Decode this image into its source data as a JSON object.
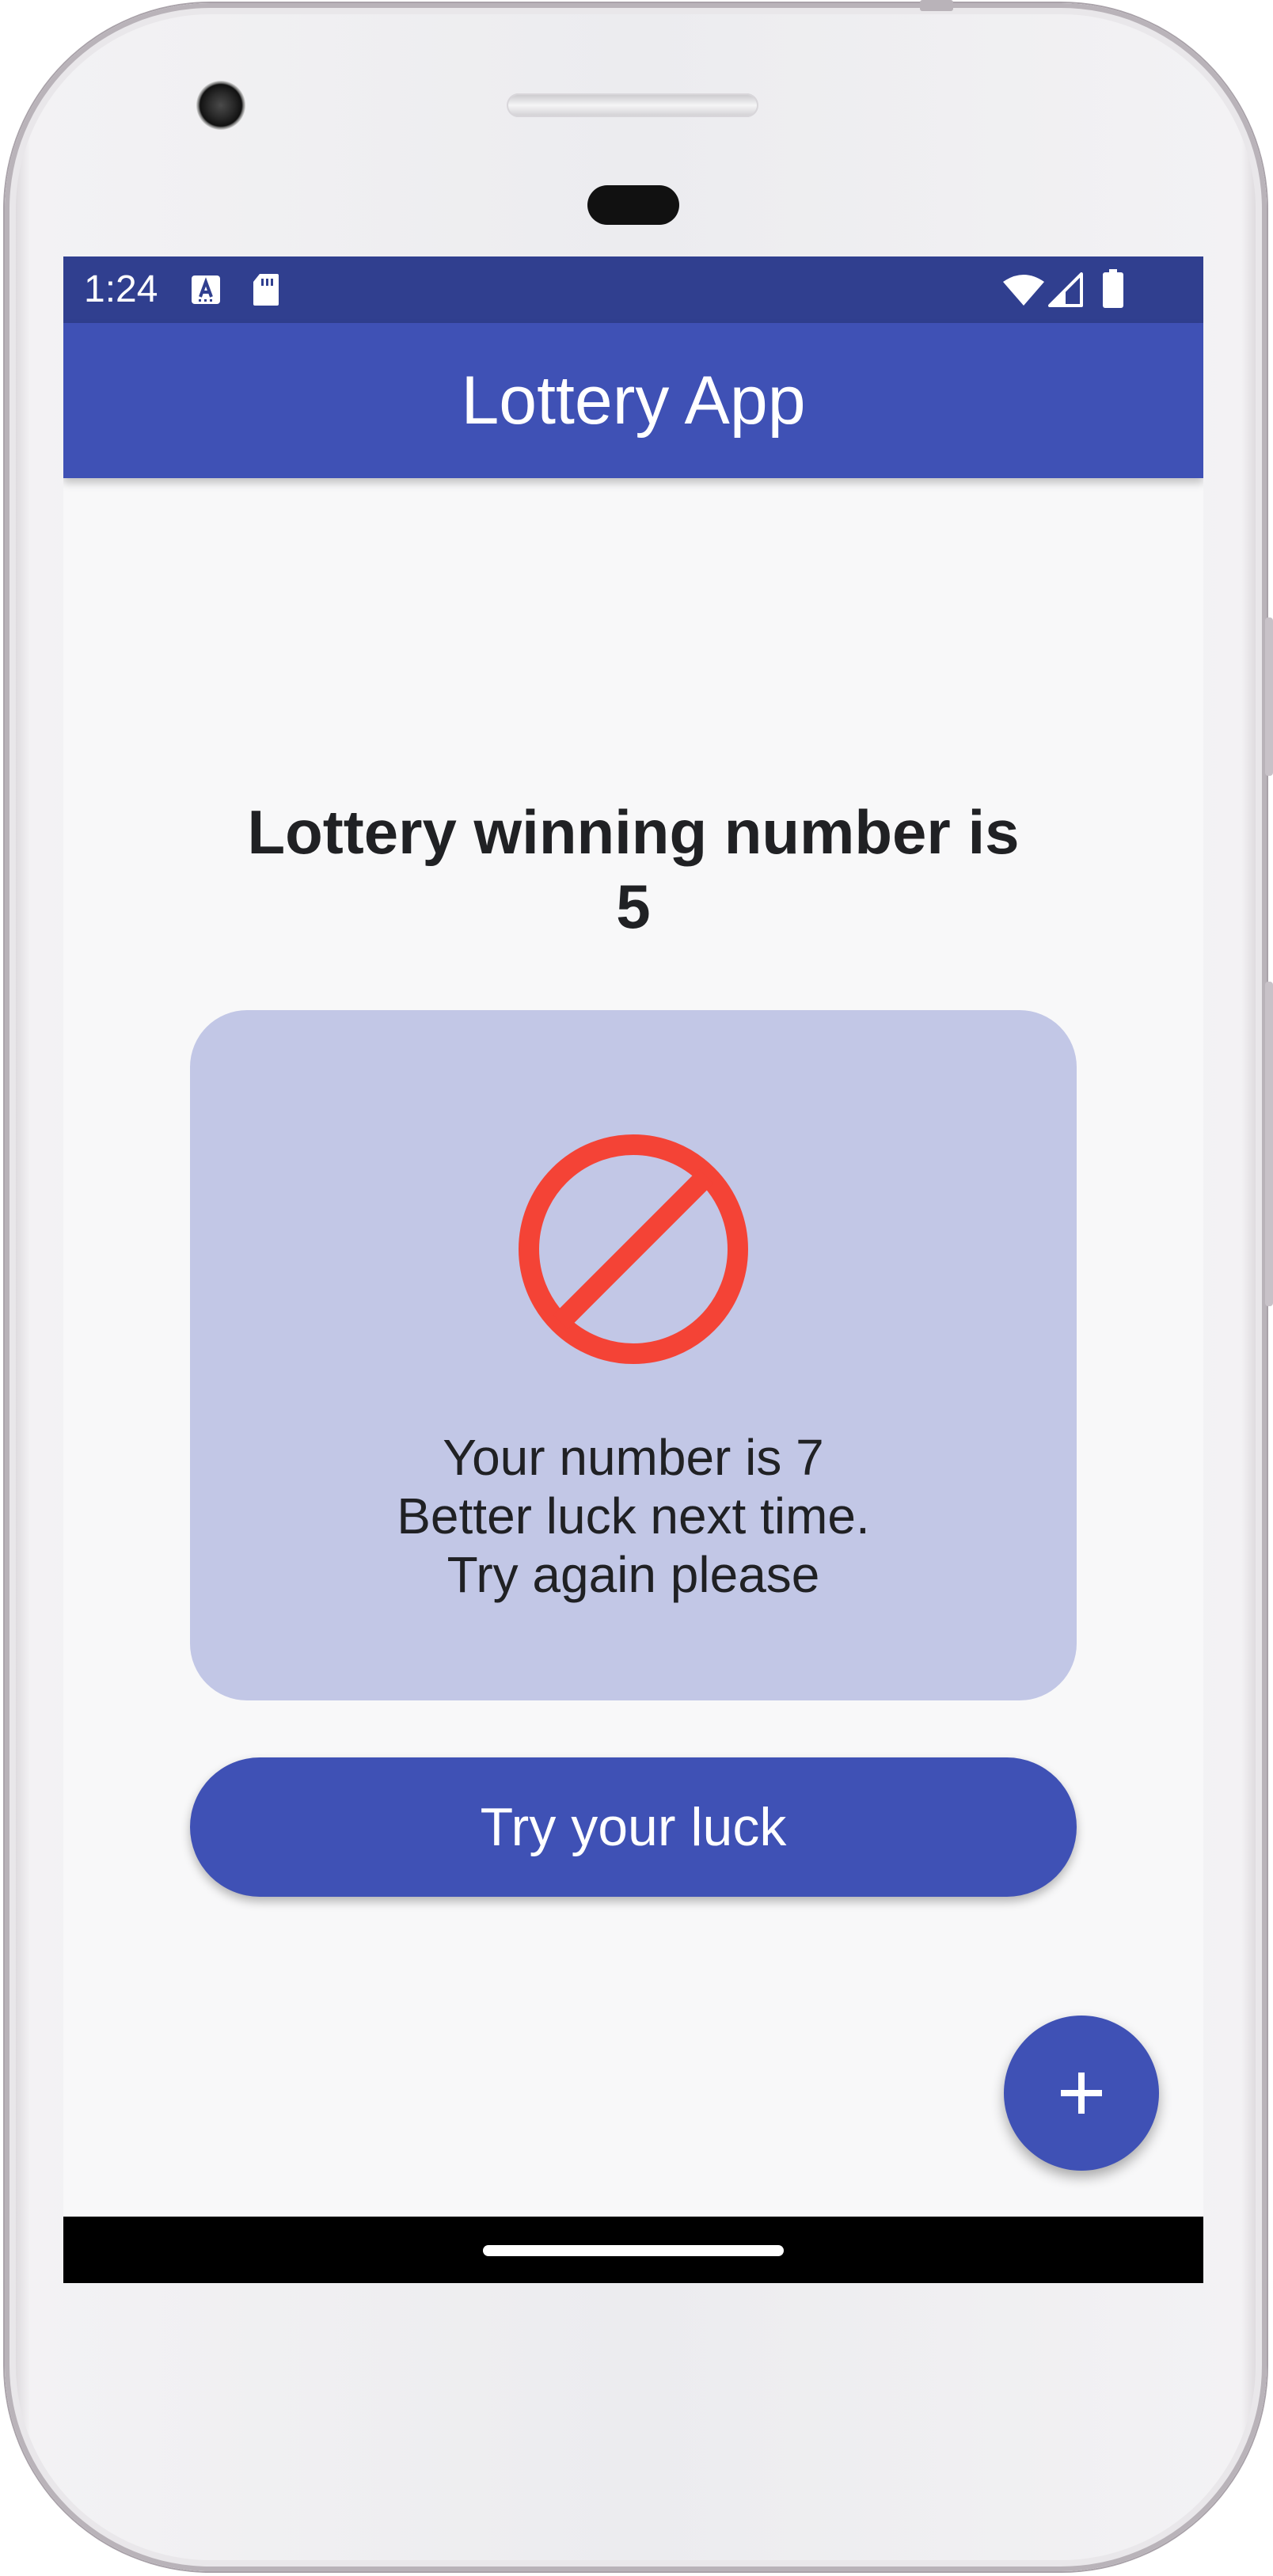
{
  "status_bar": {
    "time": "1:24",
    "icons": [
      "font-notification-icon",
      "sd-card-icon",
      "wifi-icon",
      "cellular-signal-icon",
      "battery-icon"
    ]
  },
  "app_bar": {
    "title": "Lottery App"
  },
  "main": {
    "headline": "Lottery winning number is",
    "winning_number": "5"
  },
  "result_card": {
    "icon": "block-icon",
    "lines": [
      "Your number is 7",
      "Better luck next time.",
      "Try again please"
    ]
  },
  "try_button": {
    "label": "Try your luck"
  },
  "fab": {
    "icon": "plus-icon"
  },
  "colors": {
    "status_bar": "#303f8f",
    "primary": "#3f51b5",
    "card_background": "#c2c7e6",
    "block_icon": "#f44336",
    "screen_background": "#f8f8f9"
  }
}
